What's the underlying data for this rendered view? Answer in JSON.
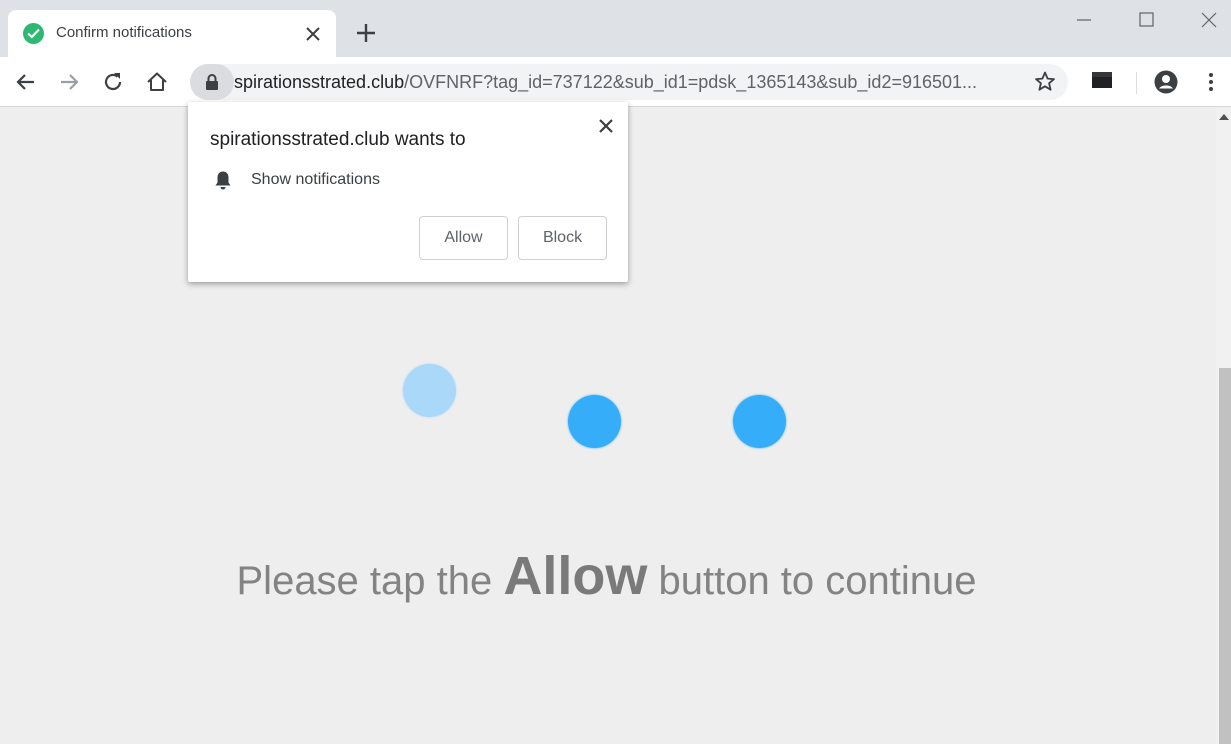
{
  "tab": {
    "title": "Confirm notifications",
    "favicon": "green-check-icon",
    "favicon_color": "#2eb872"
  },
  "toolbar": {
    "url_host": "spirationsstrated.club",
    "url_path": "/OVFNRF?tag_id=737122&sub_id1=pdsk_1365143&sub_id2=916501..."
  },
  "popup": {
    "title": "spirationsstrated.club wants to",
    "permission": "Show notifications",
    "allow_label": "Allow",
    "block_label": "Block"
  },
  "page": {
    "message_before": "Please tap the ",
    "message_strong": "Allow",
    "message_after": " button to continue",
    "dot_color": "#36adf8",
    "dot_faded_color": "#a9d8f8"
  }
}
